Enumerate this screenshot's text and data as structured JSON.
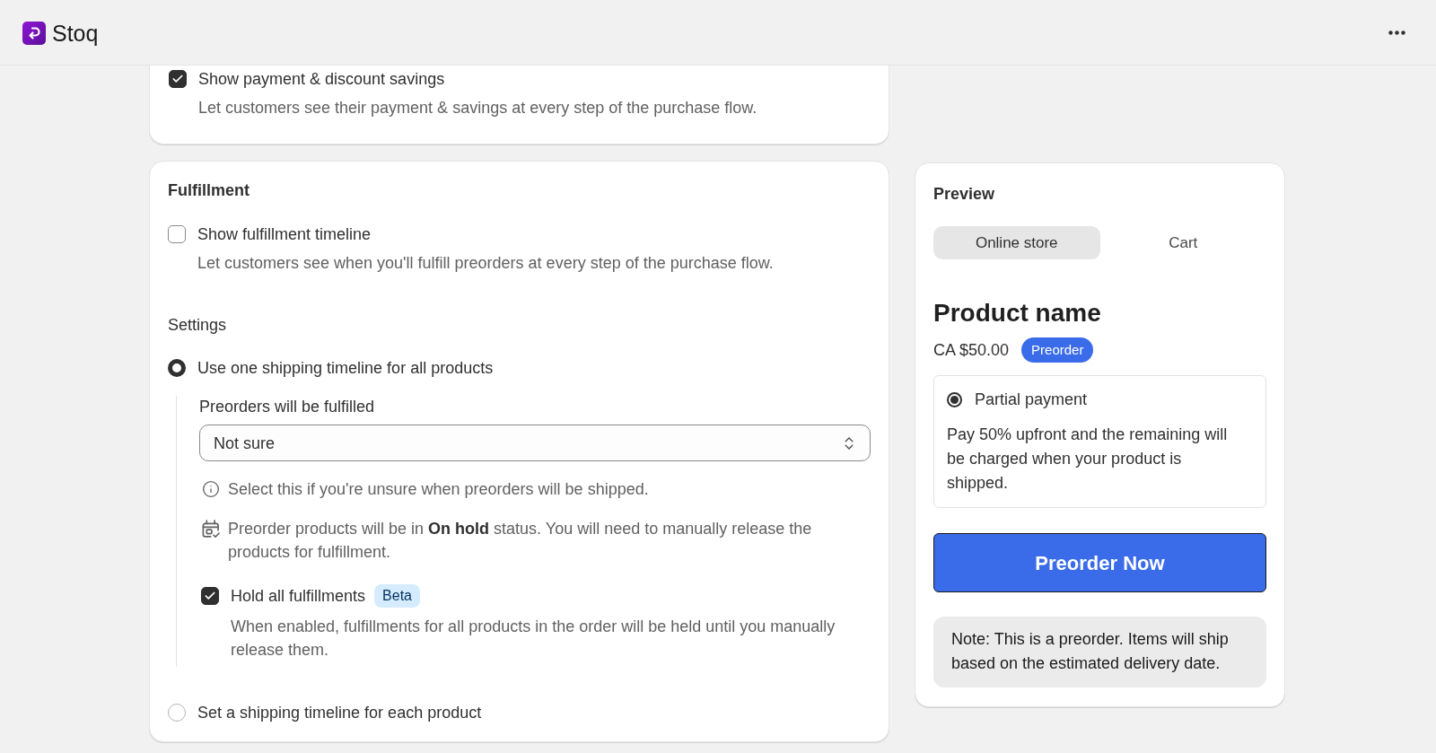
{
  "app": {
    "name": "Stoq"
  },
  "payment_savings": {
    "label": "Show payment & discount savings",
    "checked": true,
    "description": "Let customers see their payment & savings at every step of the purchase flow."
  },
  "fulfillment": {
    "title": "Fulfillment",
    "timeline": {
      "label": "Show fulfillment timeline",
      "checked": false,
      "description": "Let customers see when you'll fulfill preorders at every step of the purchase flow."
    },
    "settings": {
      "title": "Settings",
      "options": [
        {
          "label": "Use one shipping timeline for all products",
          "selected": true,
          "details": {
            "field_label": "Preorders will be fulfilled",
            "select": {
              "value": "Not sure"
            },
            "notes": [
              {
                "kind": "info",
                "text": "Select this if you're unsure when preorders will be shipped."
              },
              {
                "kind": "hold",
                "text": "Preorder products will be in **On hold** status. You will need to manually release the products for fulfillment."
              }
            ],
            "hold_all": {
              "label": "Hold all fulfillments",
              "badge": "Beta",
              "checked": true,
              "description": "When enabled, fulfillments for all products in the order will be held until you manually release them."
            }
          }
        },
        {
          "label": "Set a shipping timeline for each product",
          "selected": false
        }
      ]
    }
  },
  "preview": {
    "title": "Preview",
    "tabs": [
      {
        "label": "Online store",
        "selected": true
      },
      {
        "label": "Cart",
        "selected": false
      }
    ],
    "product_name": "Product name",
    "price": "CA $50.00",
    "badge": "Preorder",
    "payment_option": {
      "label": "Partial payment",
      "selected": true,
      "description": "Pay 50% upfront and the remaining will be charged when your product is shipped."
    },
    "button": "Preorder Now",
    "note": "Note: This is a preorder. Items will ship based on the estimated delivery date."
  }
}
